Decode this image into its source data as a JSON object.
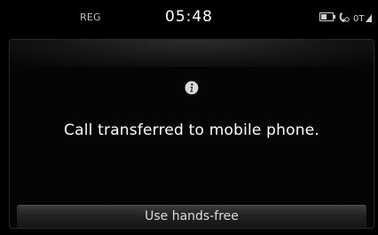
{
  "status_bar": {
    "left_label": "REG",
    "clock": "05:48",
    "icons": [
      "battery-icon",
      "phone-bluetooth-icon",
      "signal-icon"
    ]
  },
  "popup": {
    "icon": "info-icon",
    "message": "Call transferred to mobile phone.",
    "action_label": "Use hands-free"
  },
  "colors": {
    "background": "#000000",
    "text": "#ffffff",
    "button": "#222222"
  }
}
